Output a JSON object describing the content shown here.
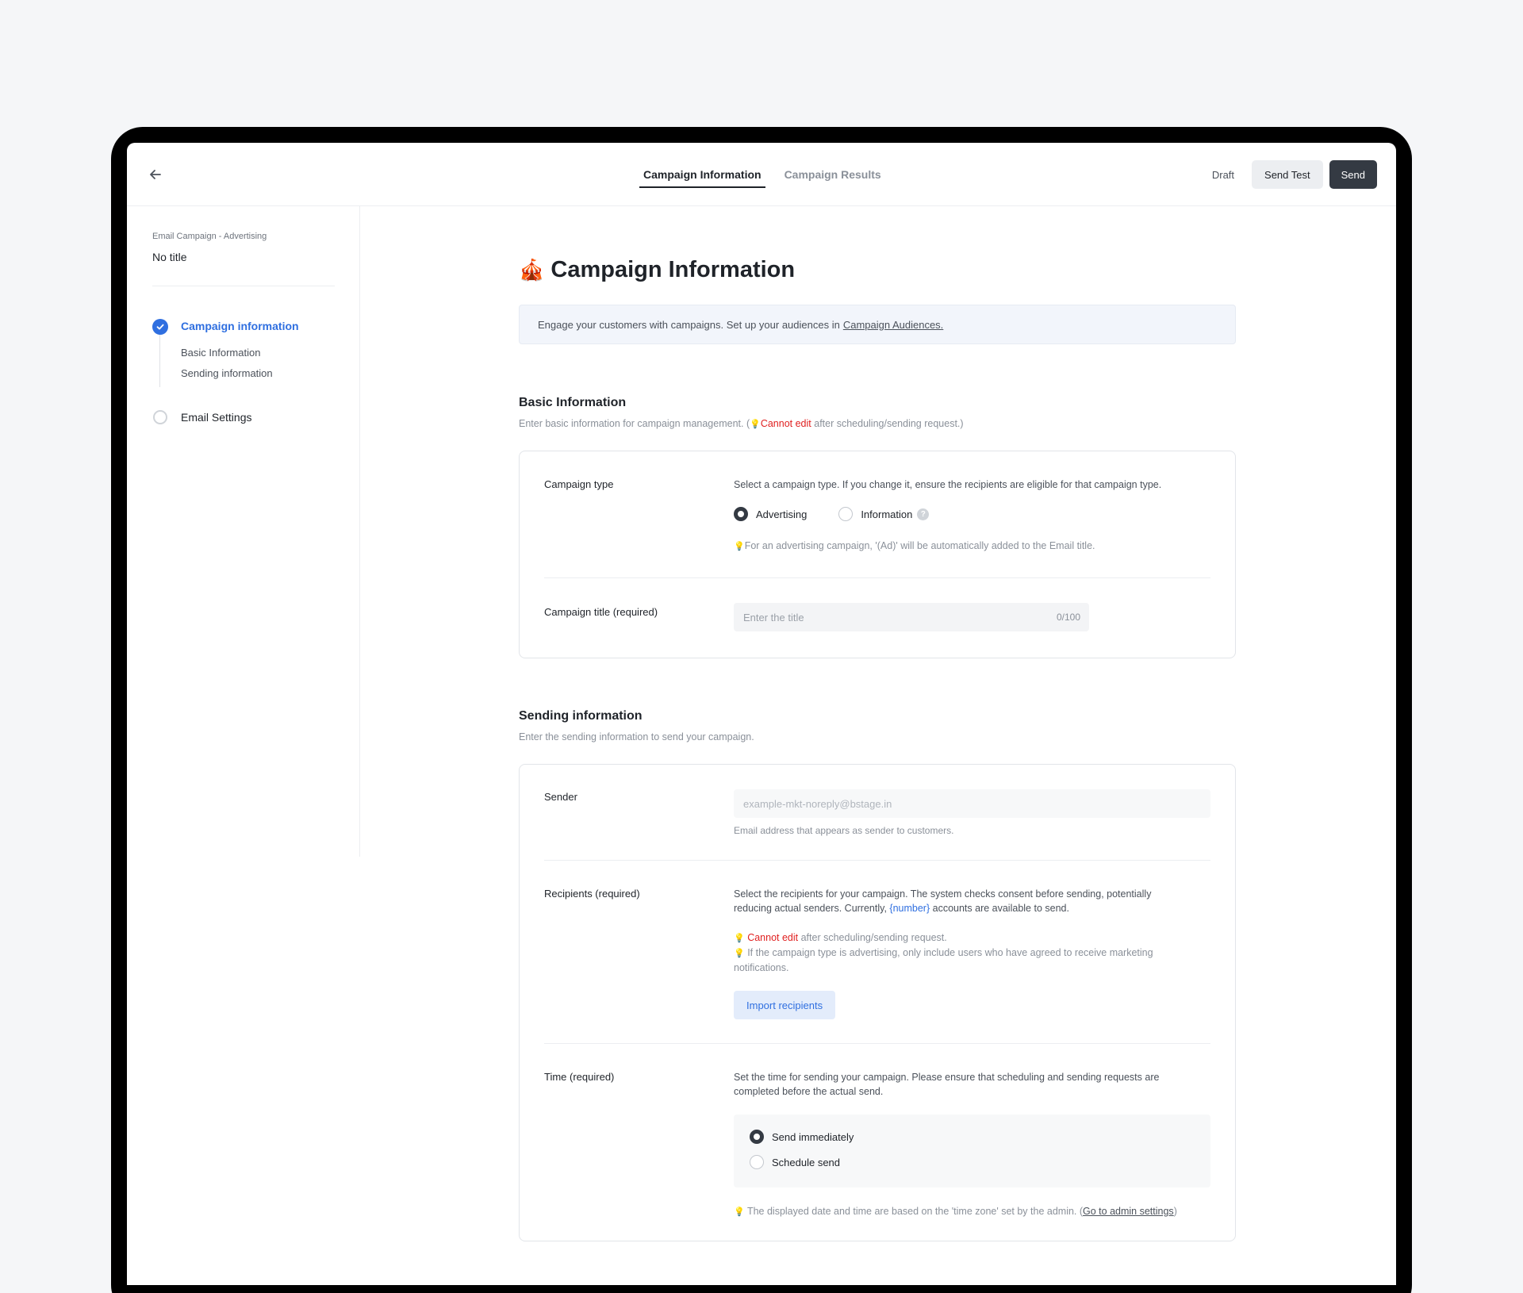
{
  "header": {
    "back_label": "Back",
    "tabs": [
      {
        "label": "Campaign Information",
        "active": true
      },
      {
        "label": "Campaign Results",
        "active": false
      }
    ],
    "status": "Draft",
    "send_test_label": "Send Test",
    "send_label": "Send"
  },
  "sidebar": {
    "caption": "Email Campaign - Advertising",
    "title": "No title",
    "steps": [
      {
        "label": "Campaign information",
        "done": true,
        "sub_items": [
          "Basic Information",
          "Sending information"
        ]
      },
      {
        "label": "Email Settings",
        "done": false
      }
    ]
  },
  "main": {
    "title_emoji": "🎪",
    "title": "Campaign Information",
    "banner": {
      "text": "Engage your customers with campaigns. Set up your audiences in",
      "link": "Campaign Audiences."
    },
    "basic": {
      "title": "Basic Information",
      "desc_prefix": "Enter basic information for campaign management. (",
      "desc_icon": "💡",
      "desc_red": "Cannot edit",
      "desc_suffix": " after scheduling/sending request.)",
      "campaign_type": {
        "label": "Campaign type",
        "description": "Select a campaign type. If you change it, ensure the recipients are eligible for that campaign type.",
        "options": [
          {
            "label": "Advertising",
            "selected": true
          },
          {
            "label": "Information",
            "selected": false
          }
        ],
        "help": "?",
        "hint_icon": "💡",
        "hint": "For an advertising campaign, '(Ad)' will be automatically added to the Email title."
      },
      "campaign_title": {
        "label": "Campaign title (required)",
        "placeholder": "Enter the title",
        "counter": "0/100"
      }
    },
    "sending": {
      "title": "Sending information",
      "desc": "Enter the sending information to send your campaign.",
      "sender": {
        "label": "Sender",
        "placeholder": "example-mkt-noreply@bstage.in",
        "hint": "Email address that appears as sender to customers."
      },
      "recipients": {
        "label": "Recipients (required)",
        "line1": "Select the recipients for your campaign. The system checks consent before sending, potentially",
        "line2_prefix": "reducing actual senders. Currently, ",
        "line2_var": "{number}",
        "line2_suffix": " accounts are available to send.",
        "hint_icon": "💡",
        "hint1_red": "Cannot edit",
        "hint1_suffix": " after scheduling/sending request.",
        "hint2_line1": "If the campaign type is advertising, only include users who have agreed to receive marketing",
        "hint2_line2": "notifications.",
        "import_label": "Import recipients"
      },
      "time": {
        "label": "Time (required)",
        "line1": "Set the time for sending your campaign. Please ensure that scheduling and sending requests are",
        "line2": "completed before the actual send.",
        "options": [
          {
            "label": "Send immediately",
            "selected": true
          },
          {
            "label": "Schedule send",
            "selected": false
          }
        ],
        "hint_icon": "💡",
        "hint_prefix": "The displayed date and time are based on the 'time zone' set by the admin. (",
        "hint_link": "Go to admin settings",
        "hint_suffix": ")"
      }
    }
  },
  "colors": {
    "accent": "#2f6fe0",
    "error": "#e02020",
    "primary_button": "#343a43",
    "page_bg": "#f5f6f8"
  }
}
